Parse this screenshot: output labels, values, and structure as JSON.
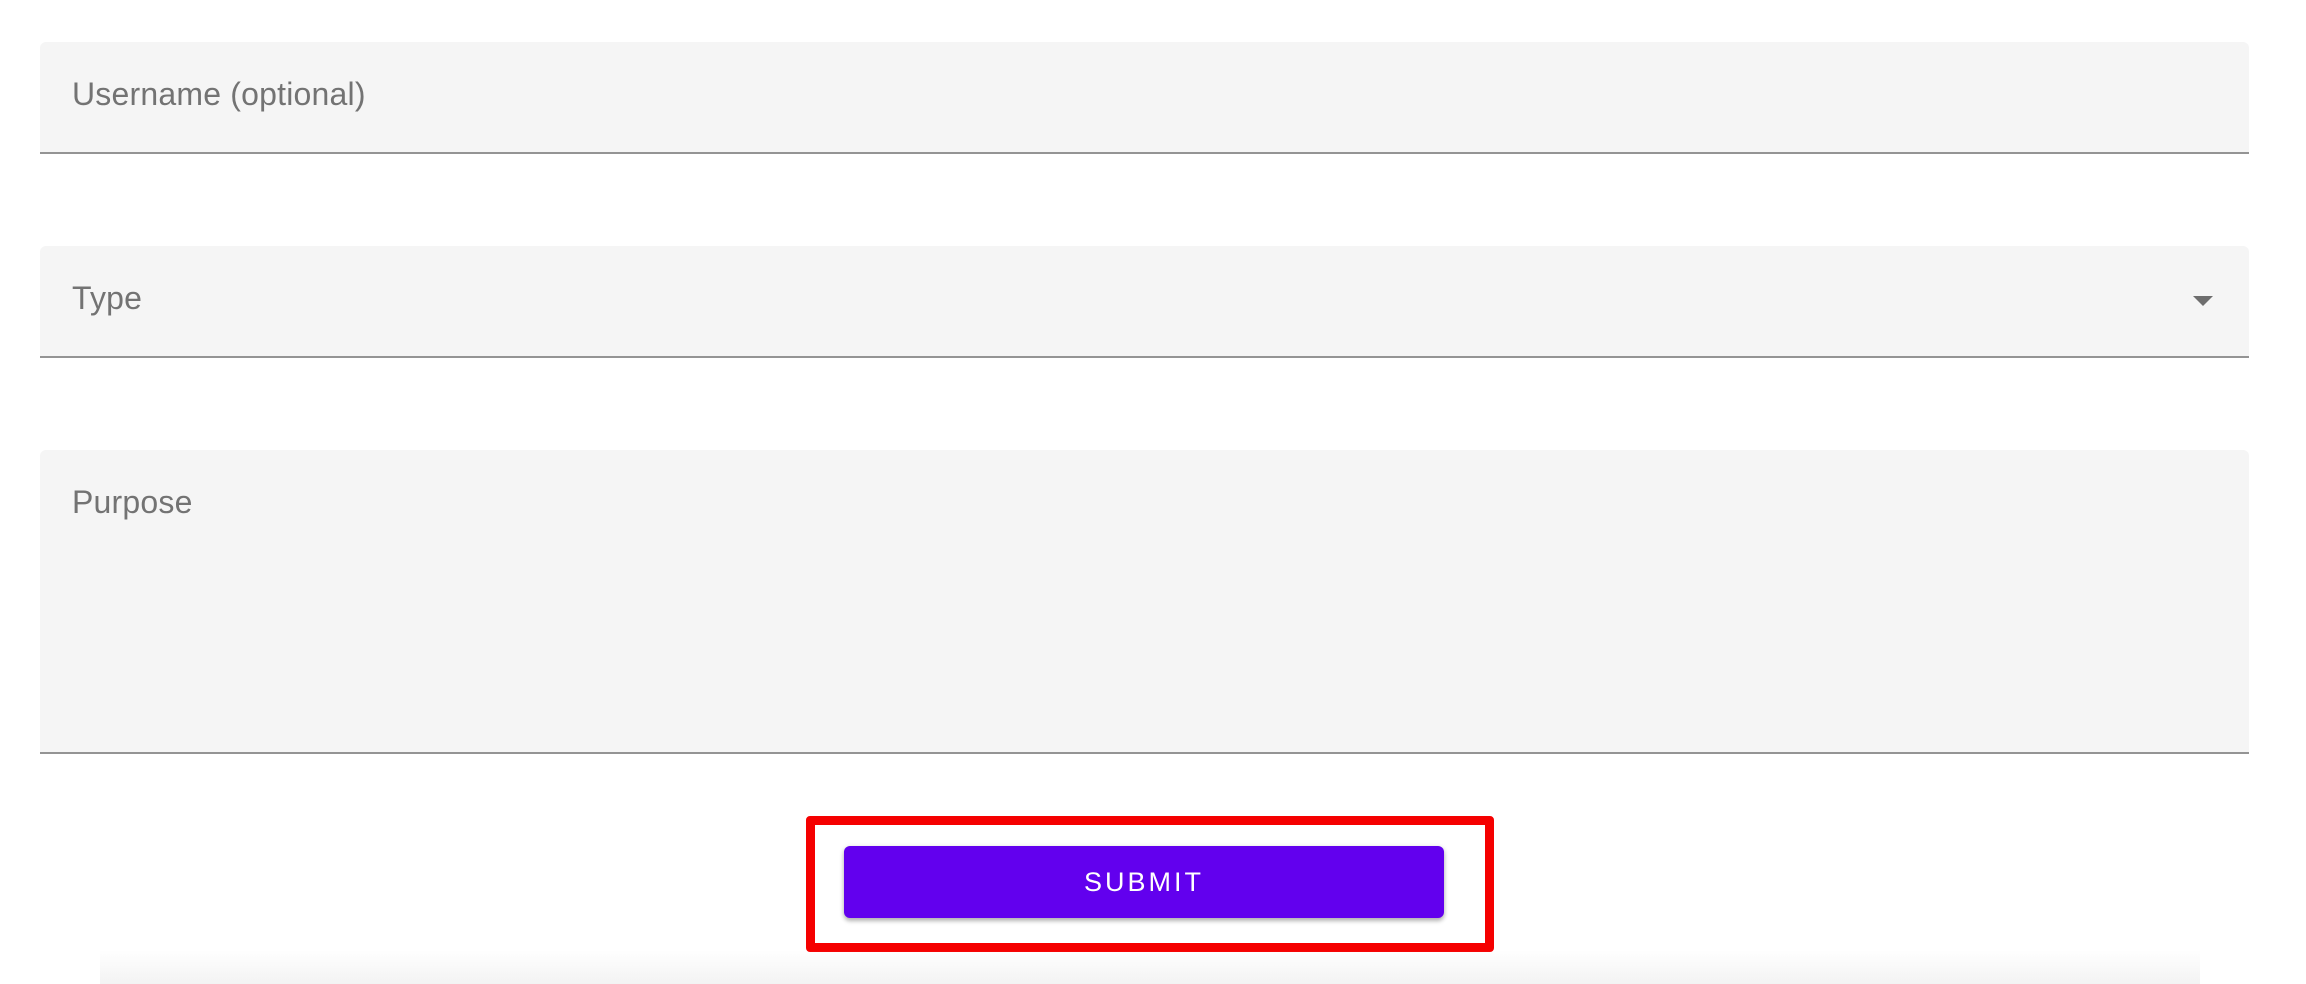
{
  "form": {
    "username": {
      "label": "Username (optional)",
      "value": ""
    },
    "type": {
      "label": "Type",
      "selected": ""
    },
    "purpose": {
      "label": "Purpose",
      "value": ""
    },
    "submit_label": "SUBMIT"
  },
  "colors": {
    "accent": "#6200ee",
    "highlight": "#f50000",
    "field_background": "#f5f5f5",
    "label_text": "#737373"
  },
  "icons": {
    "type_dropdown": "caret-down-icon"
  }
}
